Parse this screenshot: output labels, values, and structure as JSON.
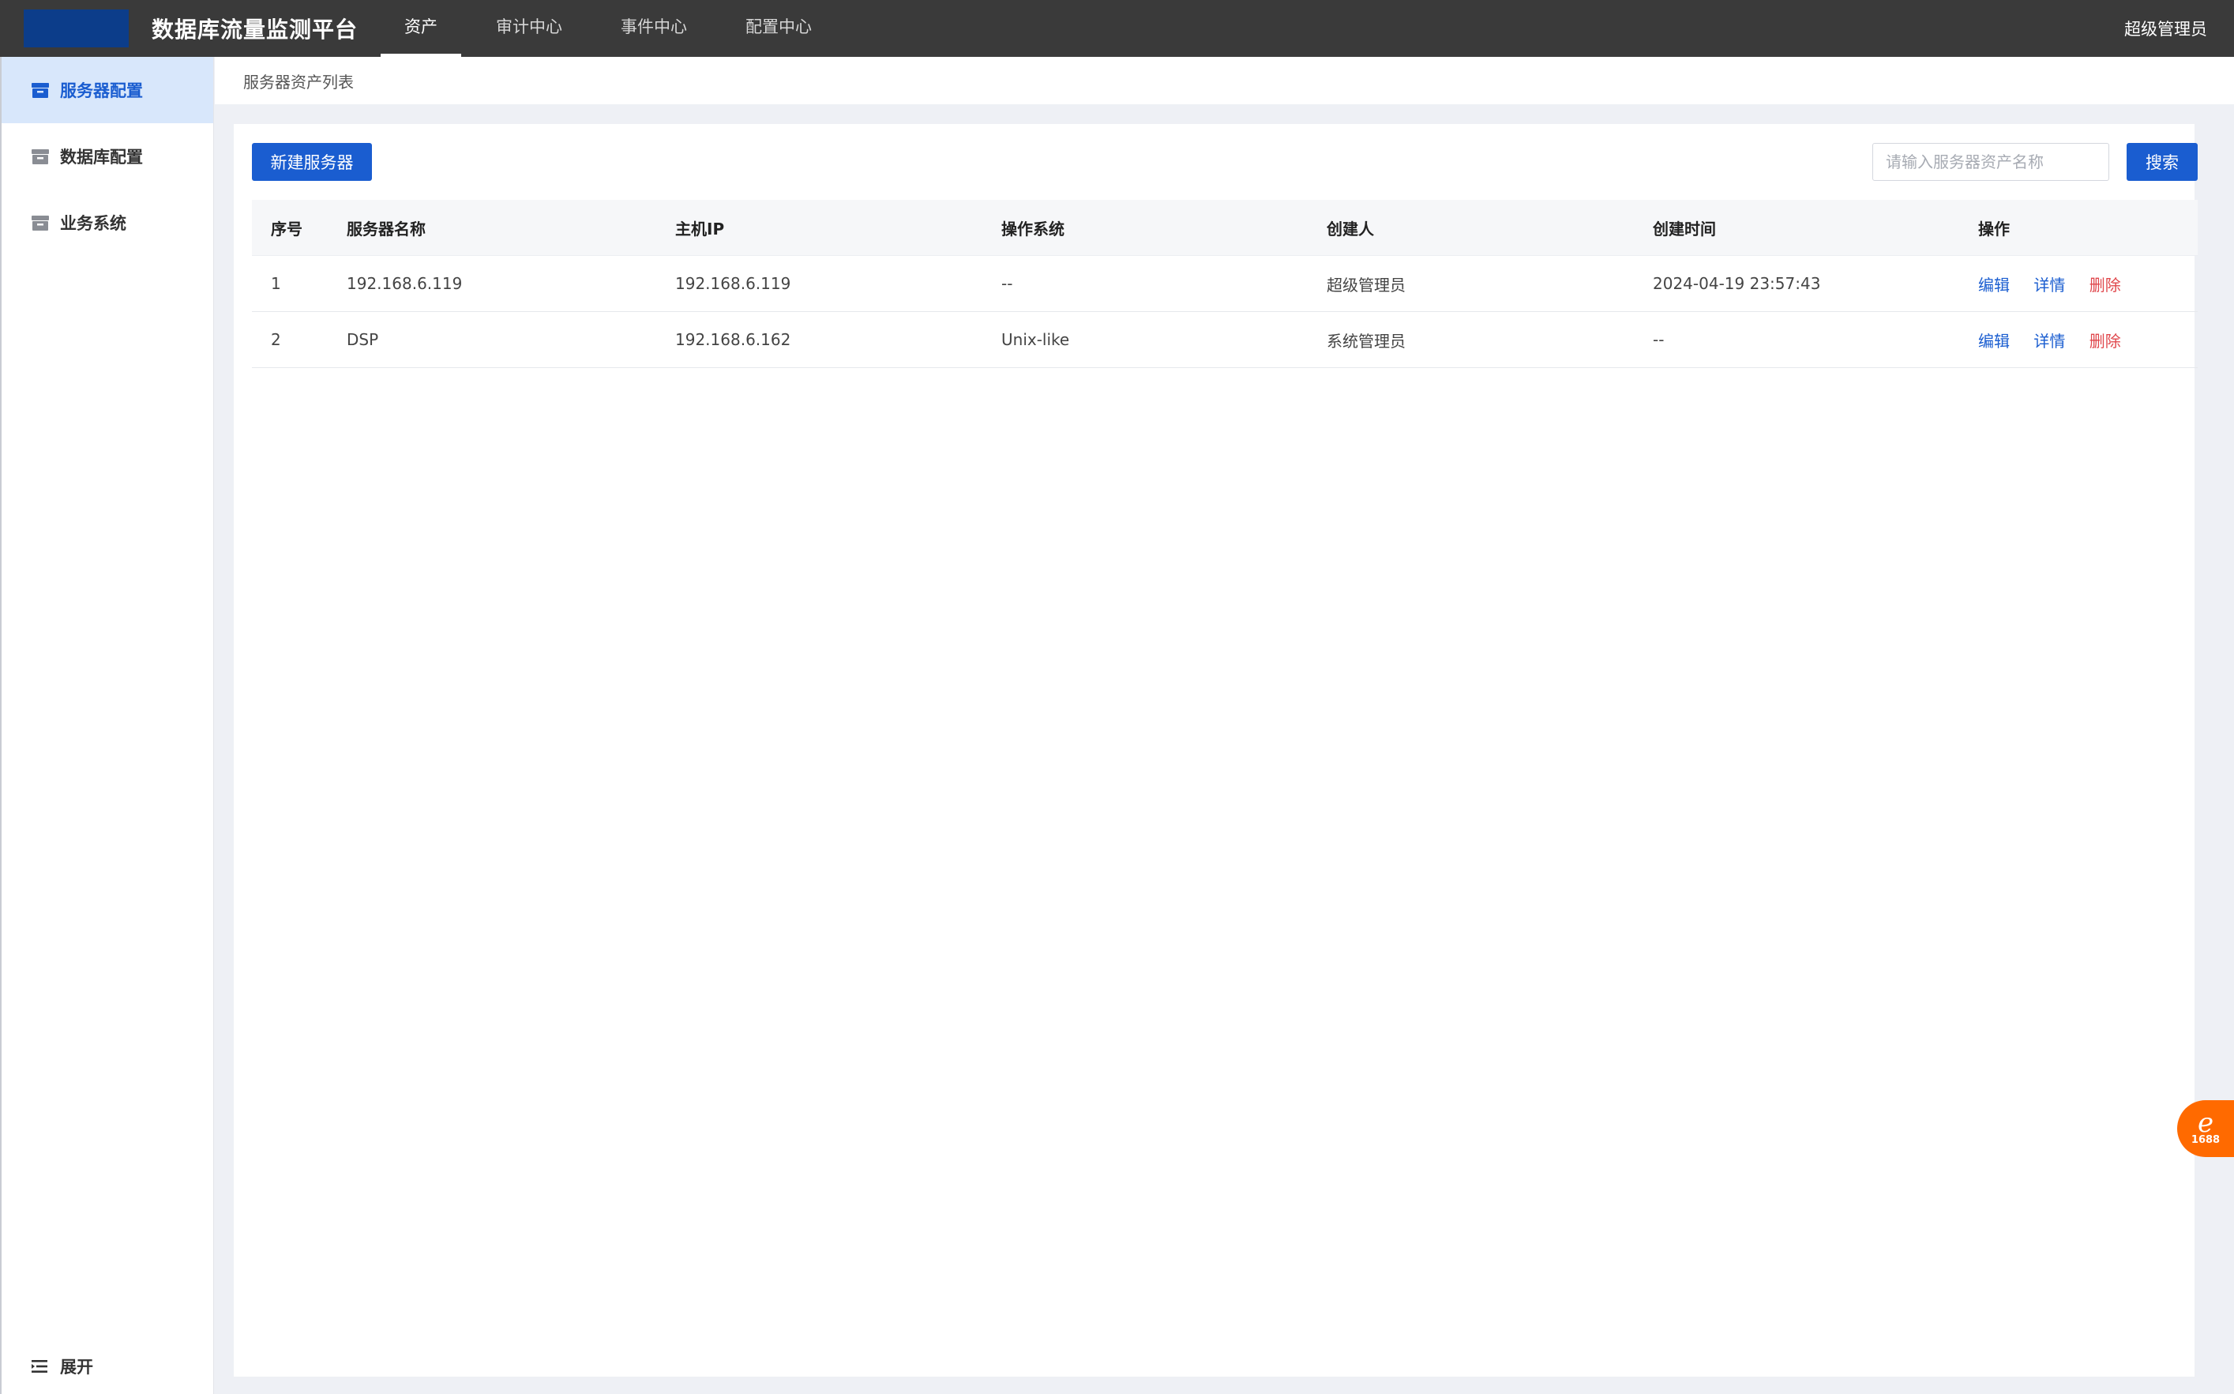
{
  "header": {
    "app_title": "数据库流量监测平台",
    "user": "超级管理员",
    "nav": [
      {
        "label": "资产",
        "active": true
      },
      {
        "label": "审计中心",
        "active": false
      },
      {
        "label": "事件中心",
        "active": false
      },
      {
        "label": "配置中心",
        "active": false
      }
    ]
  },
  "sidebar": {
    "items": [
      {
        "label": "服务器配置",
        "icon": "archive-box-icon",
        "active": true
      },
      {
        "label": "数据库配置",
        "icon": "archive-box-icon",
        "active": false
      },
      {
        "label": "业务系统",
        "icon": "archive-box-icon",
        "active": false
      }
    ],
    "expand_label": "展开"
  },
  "breadcrumb": "服务器资产列表",
  "toolbar": {
    "new_button": "新建服务器",
    "search_placeholder": "请输入服务器资产名称",
    "search_button": "搜索"
  },
  "table": {
    "columns": [
      "序号",
      "服务器名称",
      "主机IP",
      "操作系统",
      "创建人",
      "创建时间",
      "操作"
    ],
    "rows": [
      {
        "index": "1",
        "name": "192.168.6.119",
        "ip": "192.168.6.119",
        "os": "--",
        "creator": "超级管理员",
        "created": "2024-04-19 23:57:43"
      },
      {
        "index": "2",
        "name": "DSP",
        "ip": "192.168.6.162",
        "os": "Unix-like",
        "creator": "系统管理员",
        "created": "--"
      }
    ],
    "actions": {
      "edit": "编辑",
      "detail": "详情",
      "delete": "删除"
    }
  },
  "float_badge": {
    "text": "1688"
  },
  "colors": {
    "topbar": "#3a3a3a",
    "primary": "#1a5dd0",
    "danger": "#e0474c",
    "sidebar_active_bg": "#d8e7fb",
    "badge": "#ff6a00"
  }
}
